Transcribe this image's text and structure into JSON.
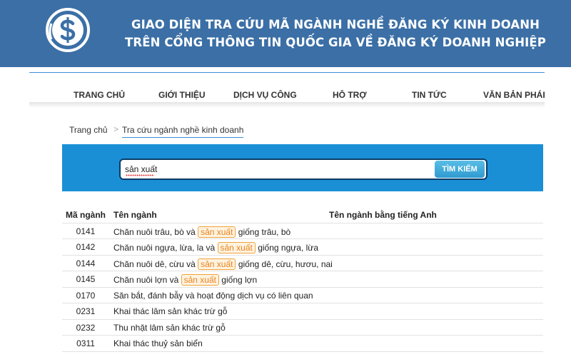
{
  "banner": {
    "title_line1": "GIAO DIỆN TRA CỨU MÃ NGÀNH NGHỀ ĐĂNG KÝ KINH DOANH",
    "title_line2": "TRÊN CỔNG THÔNG TIN QUỐC GIA VỀ ĐĂNG KÝ DOANH NGHIỆP",
    "logo_icon": "dollar-coin-logo-icon",
    "color": "#3b6fa6"
  },
  "nav": {
    "items": [
      "TRANG CHỦ",
      "GIỚI THIỆU",
      "DỊCH VỤ CÔNG",
      "HỖ TRỢ",
      "TIN TỨC",
      "VĂN BẢN PHÁP"
    ]
  },
  "breadcrumb": {
    "home": "Trang chủ",
    "separator": ">",
    "current": "Tra cứu ngành nghề kinh doanh"
  },
  "search": {
    "value": "sản xuất",
    "button_label": "TÌM KIẾM",
    "band_color": "#1a8fd6"
  },
  "table": {
    "headers": {
      "code": "Mã ngành",
      "name": "Tên ngành",
      "english": "Tên ngành bằng tiếng Anh"
    },
    "highlight_term": "sản xuất",
    "highlight_color": "#f0a23b",
    "rows": [
      {
        "code": "0141",
        "name_before": "Chăn nuôi trâu, bò và ",
        "name_highlight": "sản xuất",
        "name_after": " giống trâu, bò"
      },
      {
        "code": "0142",
        "name_before": "Chăn nuôi ngựa, lừa, la và ",
        "name_highlight": "sản xuất",
        "name_after": " giống ngựa, lừa"
      },
      {
        "code": "0144",
        "name_before": "Chăn nuôi dê, cừu và ",
        "name_highlight": "sản xuất",
        "name_after": " giống dê, cừu, hươu, nai"
      },
      {
        "code": "0145",
        "name_before": "Chăn nuôi lợn và ",
        "name_highlight": "sản xuất",
        "name_after": " giống lợn"
      },
      {
        "code": "0170",
        "name_before": "Săn bắt, đánh bẫy và hoạt động dịch vụ có liên quan",
        "name_highlight": "",
        "name_after": ""
      },
      {
        "code": "0231",
        "name_before": "Khai thác lâm sản khác trừ gỗ",
        "name_highlight": "",
        "name_after": ""
      },
      {
        "code": "0232",
        "name_before": "Thu nhặt lâm sản khác trừ gỗ",
        "name_highlight": "",
        "name_after": ""
      },
      {
        "code": "0311",
        "name_before": "Khai thác thuỷ sản biển",
        "name_highlight": "",
        "name_after": ""
      }
    ]
  }
}
